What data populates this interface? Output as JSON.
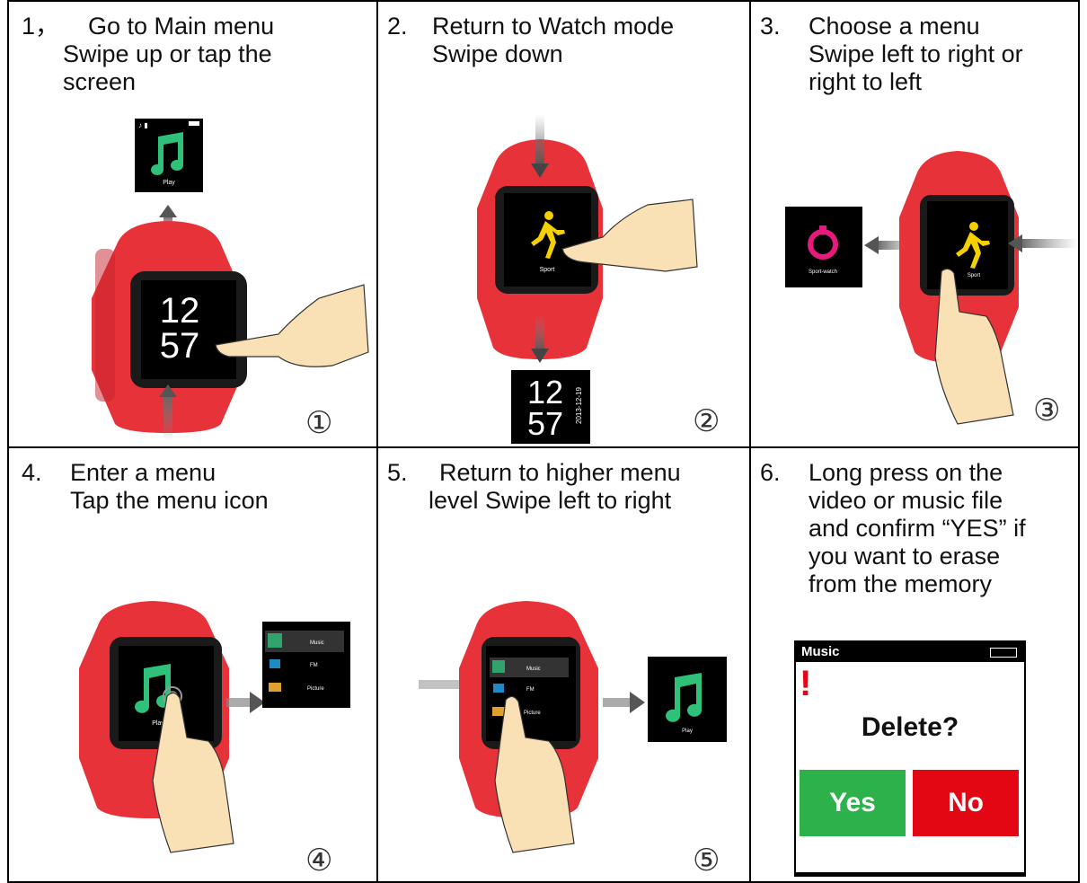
{
  "steps": [
    {
      "num": "1，",
      "lines": [
        "Go to Main menu",
        "Swipe up or tap the",
        "screen"
      ],
      "badge": "①"
    },
    {
      "num": "2.",
      "lines": [
        "Return to Watch mode",
        "Swipe down"
      ],
      "badge": "②"
    },
    {
      "num": "3.",
      "lines": [
        "Choose a menu",
        "Swipe left to right or",
        "right to left"
      ],
      "badge": "③"
    },
    {
      "num": "4.",
      "lines": [
        "Enter a menu",
        "Tap the menu icon"
      ],
      "badge": "④"
    },
    {
      "num": "5.",
      "lines": [
        "Return to higher menu",
        "level Swipe left to right"
      ],
      "badge": "⑤"
    },
    {
      "num": "6.",
      "lines": [
        "Long press on the",
        "video or music file",
        "and confirm “YES” if",
        "you want to erase",
        "from the memory"
      ],
      "badge": ""
    }
  ],
  "watch_time": {
    "hours": "12",
    "minutes": "57",
    "date": "2013-12-19"
  },
  "screens": {
    "play_label": "Play",
    "sport_label": "Sport",
    "sportwatch_label": "Sport-watch",
    "menu_items": [
      "Music",
      "FM",
      "Picture"
    ]
  },
  "delete_dialog": {
    "title": "Music",
    "question": "Delete?",
    "yes_label": "Yes",
    "no_label": "No"
  },
  "colors": {
    "watch_red": "#e8323a",
    "note_green": "#2fc07a",
    "runner_yellow": "#f5d000",
    "yes_green": "#2db14a",
    "no_red": "#e30613"
  }
}
